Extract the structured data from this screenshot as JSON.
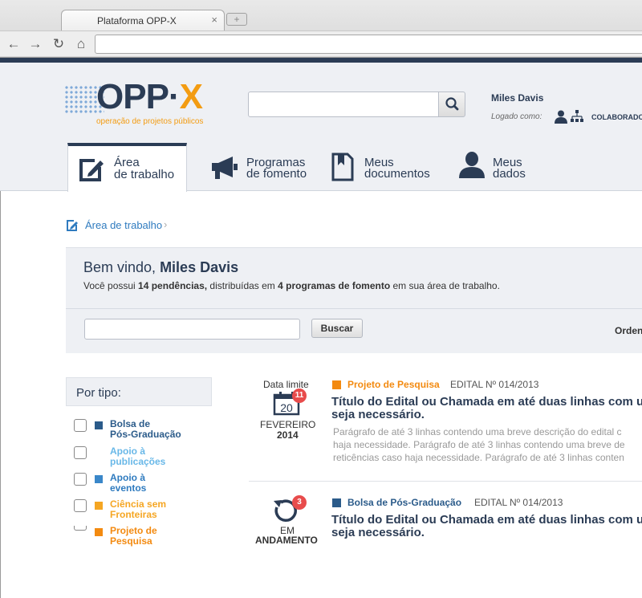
{
  "browser": {
    "tab_title": "Plataforma OPP-X",
    "tab_close": "×",
    "new_tab": "+",
    "back": "←",
    "forward": "→",
    "reload": "↻",
    "home": "⌂",
    "address_value": ""
  },
  "header": {
    "logo_main": "OPP·",
    "logo_x": "X",
    "logo_tagline": "operação de projetos públicos",
    "search_value": "",
    "user_name": "Miles Davis",
    "logged_as": "Logado como:",
    "role": "COLABORADOR"
  },
  "nav": {
    "tabs": [
      {
        "line1": "Área",
        "line2": "de trabalho",
        "icon": "workspace-icon",
        "active": true
      },
      {
        "line1": "Programas",
        "line2": "de fomento",
        "icon": "megaphone-icon",
        "active": false
      },
      {
        "line1": "Meus",
        "line2": "documentos",
        "icon": "document-icon",
        "active": false
      },
      {
        "line1": "Meus",
        "line2": "dados",
        "icon": "person-icon",
        "active": false
      }
    ]
  },
  "breadcrumb": {
    "label": "Área de trabalho",
    "separator": "›"
  },
  "welcome": {
    "greeting": "Bem vindo,",
    "name": "Miles Davis",
    "msg_part1": "Você possui ",
    "msg_count": "14 pendências,",
    "msg_part2": " distribuídas em ",
    "msg_programs": "4 programas de fomento",
    "msg_part3": " em sua área de trabalho.",
    "filter_value": "",
    "search_button": "Buscar",
    "order_label": "Ordenar"
  },
  "sidebar": {
    "heading": "Por tipo:",
    "items": [
      {
        "line1": "Bolsa de",
        "line2": "Pós-Graduação",
        "color": "#2b5b8a",
        "text_color": "#2b5b8a"
      },
      {
        "line1": "Apoio à",
        "line2": "publicações",
        "color": "#ffffff",
        "text_color": "#69b8e8"
      },
      {
        "line1": "Apoio à",
        "line2": "eventos",
        "color": "#3a87c9",
        "text_color": "#2f7bbf"
      },
      {
        "line1": "Ciência sem",
        "line2": "Fronteiras",
        "color": "#f5a623",
        "text_color": "#f5a623"
      },
      {
        "line1": "Projeto de",
        "line2": "Pesquisa",
        "color": "#f38a10",
        "text_color": "#f38a10"
      }
    ]
  },
  "listing": [
    {
      "deadline_label": "Data limite",
      "day": "20",
      "badge": "11",
      "month": "FEVEREIRO",
      "year": "2014",
      "category": "Projeto de Pesquisa",
      "category_color": "#f38a10",
      "edital": "EDITAL Nº 014/2013",
      "title_line1": "Título do Edital ou Chamada em até duas linhas com us",
      "title_line2": "seja necessário.",
      "desc_line1": "Parágrafo de até 3 linhas contendo uma breve descrição do edital c",
      "desc_line2": "haja necessidade. Parágrafo de até 3 linhas contendo uma breve de",
      "desc_line3": "reticências caso haja necessidade. Parágrafo de até 3 linhas conten"
    },
    {
      "badge": "3",
      "state_line1": "EM",
      "state_line2": "ANDAMENTO",
      "category": "Bolsa de Pós-Graduação",
      "category_color": "#2b5b8a",
      "edital": "EDITAL Nº 014/2013",
      "title_line1": "Título do Edital ou Chamada em até duas linhas com us",
      "title_line2": "seja necessário."
    }
  ]
}
